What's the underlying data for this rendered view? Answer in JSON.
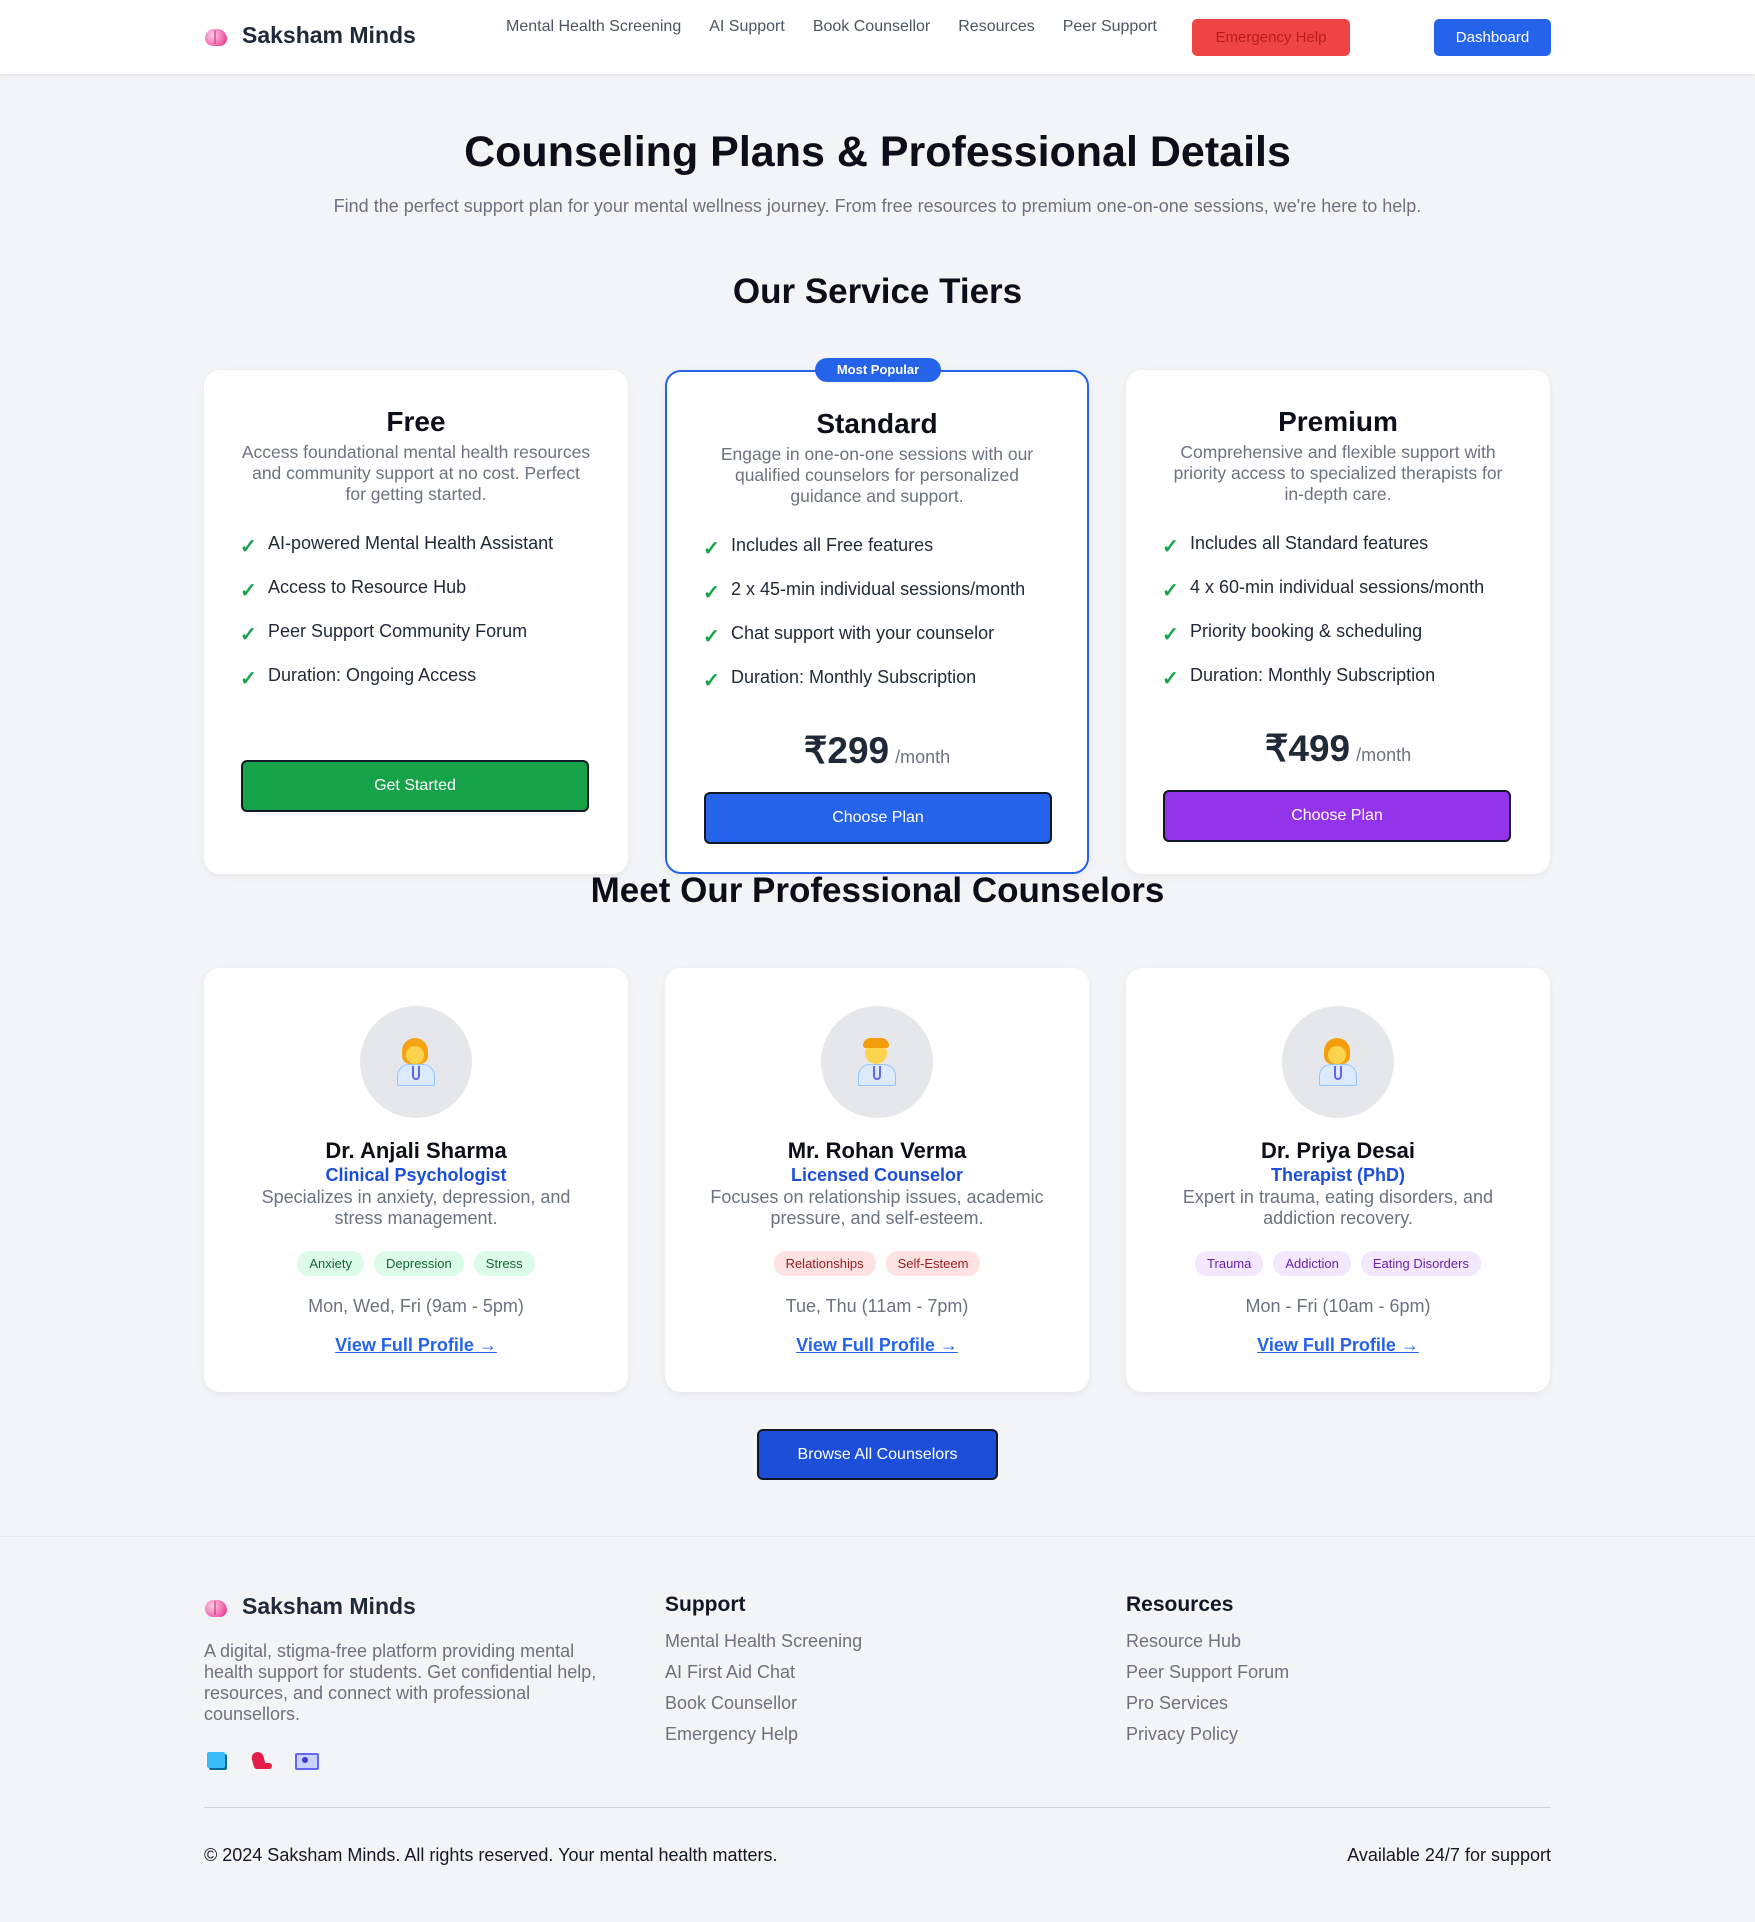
{
  "nav": {
    "brand": "Saksham Minds",
    "links": [
      "Mental Health Screening",
      "AI Support",
      "Book Counsellor",
      "Resources",
      "Peer Support"
    ],
    "emergency_label": "Emergency Help",
    "dashboard_label": "Dashboard"
  },
  "hero": {
    "title": "Counseling Plans & Professional Details",
    "subtitle": "Find the perfect support plan for your mental wellness journey. From free resources to premium one-on-one sessions, we're here to help."
  },
  "tiers": {
    "heading": "Our Service Tiers",
    "popular_badge": "Most Popular",
    "plans": [
      {
        "name": "Free",
        "description": "Access foundational mental health resources and community support at no cost. Perfect for getting started.",
        "features": [
          "AI-powered Mental Health Assistant",
          "Access to Resource Hub",
          "Peer Support Community Forum",
          "Duration: Ongoing Access"
        ],
        "price": "",
        "per": "",
        "button": "Get Started",
        "button_color": "#16a34a"
      },
      {
        "name": "Standard",
        "description": "Engage in one-on-one sessions with our qualified counselors for personalized guidance and support.",
        "features": [
          "Includes all Free features",
          "2 x 45-min individual sessions/month",
          "Chat support with your counselor",
          "Duration: Monthly Subscription"
        ],
        "price": "₹299",
        "per": "/month",
        "button": "Choose Plan",
        "button_color": "#2563eb"
      },
      {
        "name": "Premium",
        "description": "Comprehensive and flexible support with priority access to specialized therapists for in-depth care.",
        "features": [
          "Includes all Standard features",
          "4 x 60-min individual sessions/month",
          "Priority booking & scheduling",
          "Duration: Monthly Subscription"
        ],
        "price": "₹499",
        "per": "/month",
        "button": "Choose Plan",
        "button_color": "#9333ea"
      }
    ]
  },
  "counselors": {
    "heading": "Meet Our Professional Counselors",
    "check_icon": "check-icon",
    "list": [
      {
        "name": "Dr. Anjali Sharma",
        "title": "Clinical Psychologist",
        "description": "Specializes in anxiety, depression, and stress management.",
        "tags": [
          "Anxiety",
          "Depression",
          "Stress"
        ],
        "hours": "Mon, Wed, Fri (9am - 5pm)",
        "link": "View Full Profile →",
        "avatar_icon": "female-health-worker-icon"
      },
      {
        "name": "Mr. Rohan Verma",
        "title": "Licensed Counselor",
        "description": "Focuses on relationship issues, academic pressure, and self-esteem.",
        "tags": [
          "Relationships",
          "Self-Esteem"
        ],
        "hours": "Tue, Thu (11am - 7pm)",
        "link": "View Full Profile →",
        "avatar_icon": "male-health-worker-icon"
      },
      {
        "name": "Dr. Priya Desai",
        "title": "Therapist (PhD)",
        "description": "Expert in trauma, eating disorders, and addiction recovery.",
        "tags": [
          "Trauma",
          "Addiction",
          "Eating Disorders"
        ],
        "hours": "Mon - Fri (10am - 6pm)",
        "link": "View Full Profile →",
        "avatar_icon": "female-health-worker-icon"
      }
    ],
    "browse_label": "Browse All Counselors"
  },
  "footer": {
    "brand": "Saksham Minds",
    "description": "A digital, stigma-free platform providing mental health support for students. Get confidential help, resources, and connect with professional counsellors.",
    "social_icons": [
      "book-icon",
      "flexed-arm-icon",
      "laptop-icon"
    ],
    "support": {
      "heading": "Support",
      "links": [
        "Mental Health Screening",
        "AI First Aid Chat",
        "Book Counsellor",
        "Emergency Help"
      ]
    },
    "resources": {
      "heading": "Resources",
      "links": [
        "Resource Hub",
        "Peer Support Forum",
        "Pro Services",
        "Privacy Policy"
      ]
    },
    "copyright": "© 2024 Saksham Minds. All rights reserved. Your mental health matters.",
    "availability": "Available 24/7 for support"
  }
}
